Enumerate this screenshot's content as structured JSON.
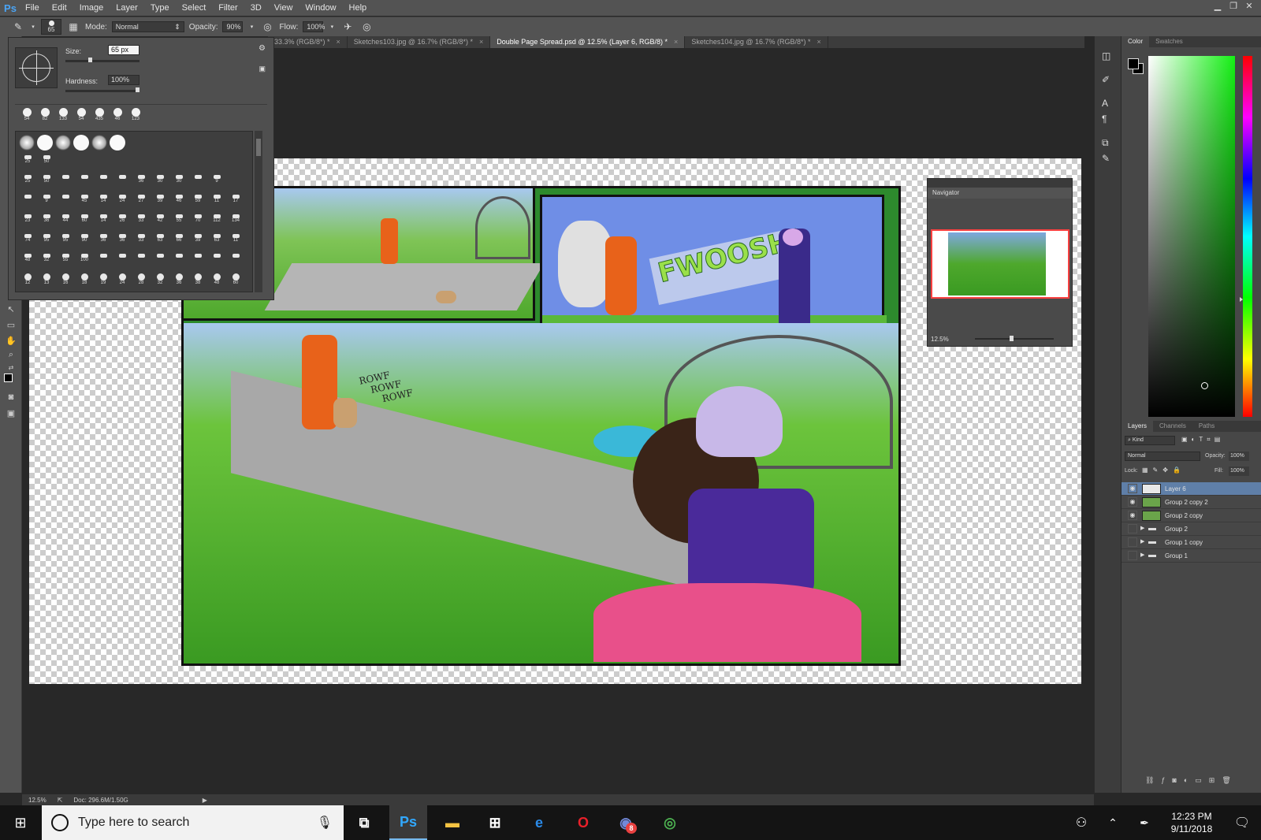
{
  "app": {
    "logo": "Ps"
  },
  "menu": [
    "File",
    "Edit",
    "Image",
    "Layer",
    "Type",
    "Select",
    "Filter",
    "3D",
    "View",
    "Window",
    "Help"
  ],
  "options": {
    "brush_size": "65",
    "mode_label": "Mode:",
    "mode_value": "Normal",
    "opacity_label": "Opacity:",
    "opacity_value": "90%",
    "flow_label": "Flow:",
    "flow_value": "100%"
  },
  "tabs": [
    {
      "label": "33.3% (RGB/8*) *",
      "active": false
    },
    {
      "label": "Sketches103.jpg @ 16.7% (RGB/8*) *",
      "active": false
    },
    {
      "label": "Double Page Spread.psd @ 12.5% (Layer 6, RGB/8) *",
      "active": true
    },
    {
      "label": "Sketches104.jpg @ 16.7% (RGB/8*) *",
      "active": false
    }
  ],
  "brush_picker": {
    "size_label": "Size:",
    "size_value": "65 px",
    "hardness_label": "Hardness:",
    "hardness_value": "100%",
    "recent_sizes": [
      "54",
      "82",
      "133",
      "54",
      "435",
      "46",
      "123"
    ],
    "row_labels": [
      [
        "25",
        "50"
      ],
      [
        "25",
        "50",
        "",
        "",
        "",
        "",
        "36",
        "30",
        "30",
        "",
        "9"
      ],
      [
        "",
        "9",
        "",
        "45",
        "14",
        "24",
        "27",
        "39",
        "46",
        "59",
        "11",
        "17"
      ],
      [
        "23",
        "36",
        "44",
        "60",
        "14",
        "26",
        "33",
        "42",
        "55",
        "70",
        "112",
        "134"
      ],
      [
        "74",
        "95",
        "95",
        "90",
        "36",
        "36",
        "33",
        "63",
        "66",
        "39",
        "63",
        "11"
      ],
      [
        "48",
        "32",
        "55",
        "100",
        "",
        "",
        "",
        "",
        "",
        "",
        "",
        ""
      ],
      [
        "12",
        "13",
        "16",
        "18",
        "19",
        "24",
        "28",
        "32",
        "36",
        "38",
        "48",
        "60"
      ]
    ]
  },
  "navigator": {
    "title": "Navigator",
    "zoom": "12.5%"
  },
  "color_panel": {
    "tabs": [
      "Color",
      "Swatches"
    ]
  },
  "layers_panel": {
    "tabs": [
      "Layers",
      "Channels",
      "Paths"
    ],
    "kind_label": "Kind",
    "blend_mode": "Normal",
    "opacity_label": "Opacity:",
    "opacity_value": "100%",
    "lock_label": "Lock:",
    "fill_label": "Fill:",
    "fill_value": "100%",
    "layers": [
      {
        "name": "Layer 6",
        "selected": true,
        "visible": true,
        "group": false
      },
      {
        "name": "Group 2 copy 2",
        "selected": false,
        "visible": true,
        "group": false
      },
      {
        "name": "Group 2 copy",
        "selected": false,
        "visible": true,
        "group": false
      },
      {
        "name": "Group 2",
        "selected": false,
        "visible": false,
        "group": true
      },
      {
        "name": "Group 1 copy",
        "selected": false,
        "visible": false,
        "group": true
      },
      {
        "name": "Group 1",
        "selected": false,
        "visible": false,
        "group": true
      }
    ]
  },
  "artwork": {
    "sfx_text": "FWOOSH!",
    "bark_text": [
      "ROWF",
      "ROWF",
      "ROWF"
    ]
  },
  "status": {
    "zoom": "12.5%",
    "doc": "Doc: 296.6M/1.50G"
  },
  "taskbar": {
    "search_placeholder": "Type here to search",
    "time": "12:23 PM",
    "date": "9/11/2018",
    "discord_badge": "8"
  }
}
